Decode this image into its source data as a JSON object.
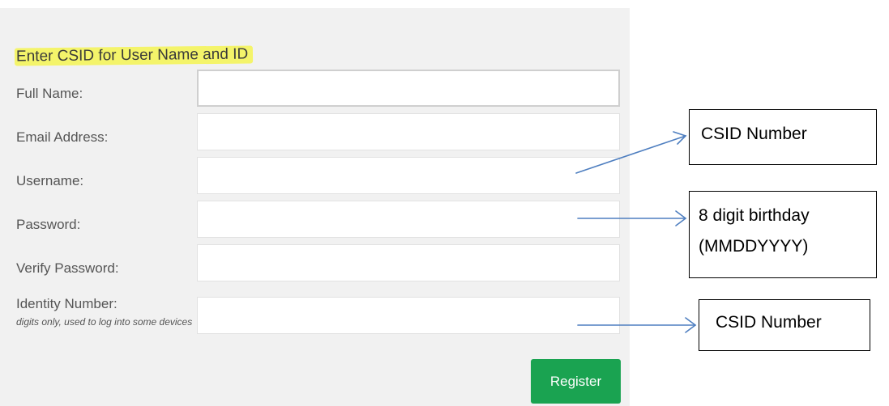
{
  "form": {
    "heading": "Enter CSID for User Name and ID",
    "fields": [
      {
        "label": "Full Name:",
        "value": "",
        "placeholder": ""
      },
      {
        "label": "Email Address:",
        "value": "",
        "placeholder": ""
      },
      {
        "label": "Username:",
        "value": "",
        "placeholder": ""
      },
      {
        "label": "Password:",
        "value": "",
        "placeholder": ""
      },
      {
        "label": "Verify Password:",
        "value": "",
        "placeholder": ""
      },
      {
        "label": "Identity Number:",
        "hint": "digits only, used to log into some devices",
        "value": "",
        "placeholder": ""
      }
    ],
    "register_label": "Register"
  },
  "annotations": {
    "username_note": "CSID Number",
    "password_note_line1": "8 digit birthday",
    "password_note_line2": "(MMDDYYYY)",
    "identity_note": "CSID Number"
  },
  "colors": {
    "panel_bg": "#f1f1f1",
    "highlight": "#f4f46a",
    "register_bg": "#1aa351",
    "arrow": "#4f7fc0"
  }
}
